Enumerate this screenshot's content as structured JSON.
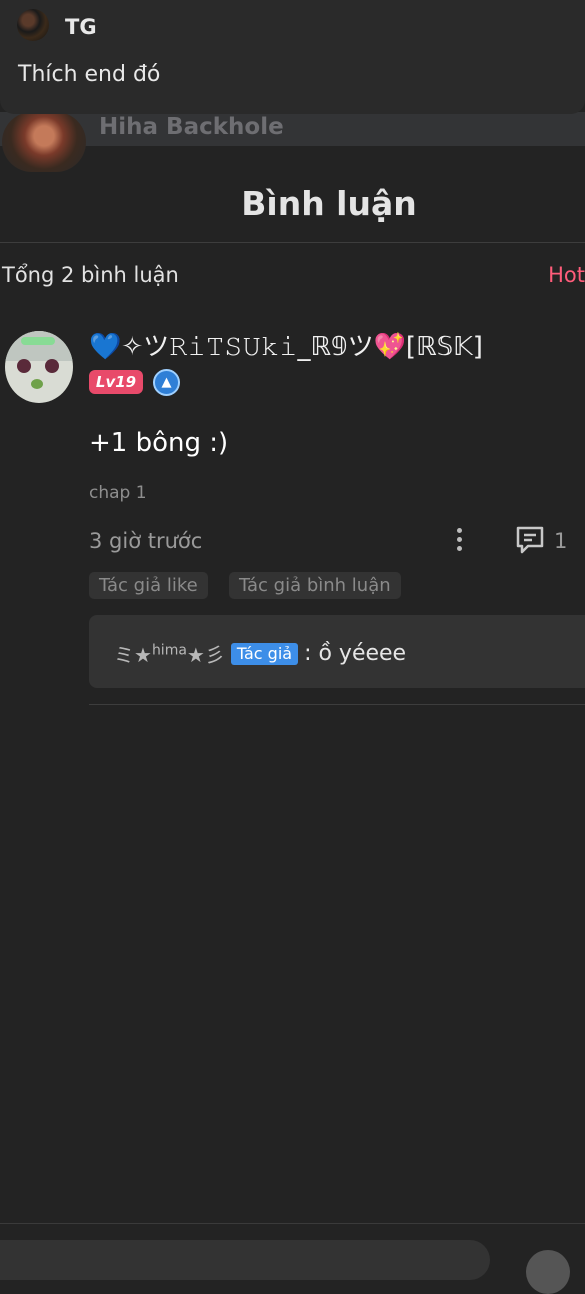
{
  "top_comment": {
    "user": "TG",
    "text": "Thích end đó"
  },
  "next_peek": {
    "user": "Hiha Backhole"
  },
  "section": {
    "title": "Bình luận"
  },
  "summary": {
    "total": "Tổng 2 bình luận",
    "sort": "Hot"
  },
  "comment": {
    "user": "💙✧ツ𝚁𝚒𝚃𝚂𝚄𝚔𝚒_ℝ𝟡ツ💖[ℝ𝕊𝕂]",
    "level": "Lv19",
    "text": "+1 bông :)",
    "chapter": "chap 1",
    "time": "3 giờ trước",
    "reply_count": "1",
    "tags": [
      "Tác giả like",
      "Tác giả bình luận"
    ],
    "reply": {
      "user": "ミ★",
      "user_sup": "hima",
      "user_end": "★彡",
      "badge": "Tác giả",
      "text": ": ồ yéeee"
    }
  },
  "colors": {
    "background": "#232323",
    "hot": "#ff5c7a",
    "level_badge": "#e84a6a",
    "author_badge": "#3d8ee8"
  }
}
